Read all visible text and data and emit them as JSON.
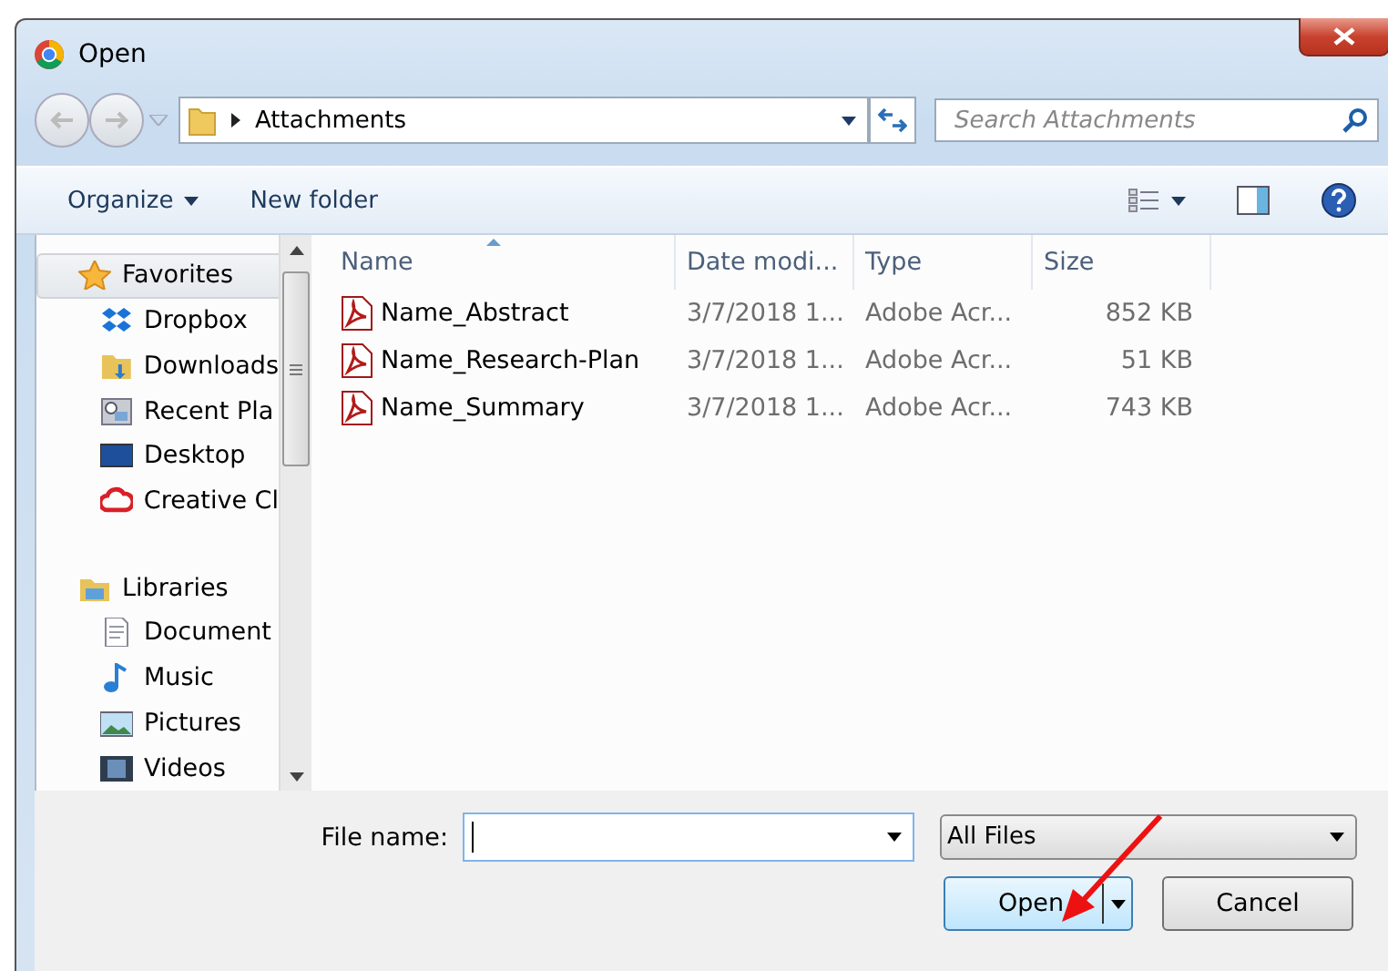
{
  "window": {
    "title": "Open"
  },
  "address": {
    "path": "Attachments"
  },
  "search": {
    "placeholder": "Search Attachments"
  },
  "toolbar": {
    "organize": "Organize",
    "new_folder": "New folder"
  },
  "sidebar": {
    "groups": [
      {
        "label": "Favorites",
        "kind": "favorites",
        "selected": true,
        "children": [
          {
            "label": "Dropbox",
            "kind": "dropbox"
          },
          {
            "label": "Downloads",
            "kind": "downloads"
          },
          {
            "label": "Recent Pla",
            "kind": "recent"
          },
          {
            "label": "Desktop",
            "kind": "desktop"
          },
          {
            "label": "Creative Cl",
            "kind": "creative"
          }
        ]
      },
      {
        "label": "Libraries",
        "kind": "libraries",
        "selected": false,
        "children": [
          {
            "label": "Document",
            "kind": "documents"
          },
          {
            "label": "Music",
            "kind": "music"
          },
          {
            "label": "Pictures",
            "kind": "pictures"
          },
          {
            "label": "Videos",
            "kind": "videos"
          }
        ]
      }
    ]
  },
  "table": {
    "columns": [
      "Name",
      "Date modi...",
      "Type",
      "Size"
    ],
    "rows": [
      {
        "name": "Name_Abstract",
        "date": "3/7/2018 1...",
        "type": "Adobe Acr...",
        "size": "852 KB"
      },
      {
        "name": "Name_Research-Plan",
        "date": "3/7/2018 1...",
        "type": "Adobe Acr...",
        "size": "51 KB"
      },
      {
        "name": "Name_Summary",
        "date": "3/7/2018 1...",
        "type": "Adobe Acr...",
        "size": "743 KB"
      }
    ]
  },
  "footer": {
    "file_name_label": "File name:",
    "filter": "All Files",
    "buttons": [
      "Open",
      "Cancel"
    ]
  }
}
